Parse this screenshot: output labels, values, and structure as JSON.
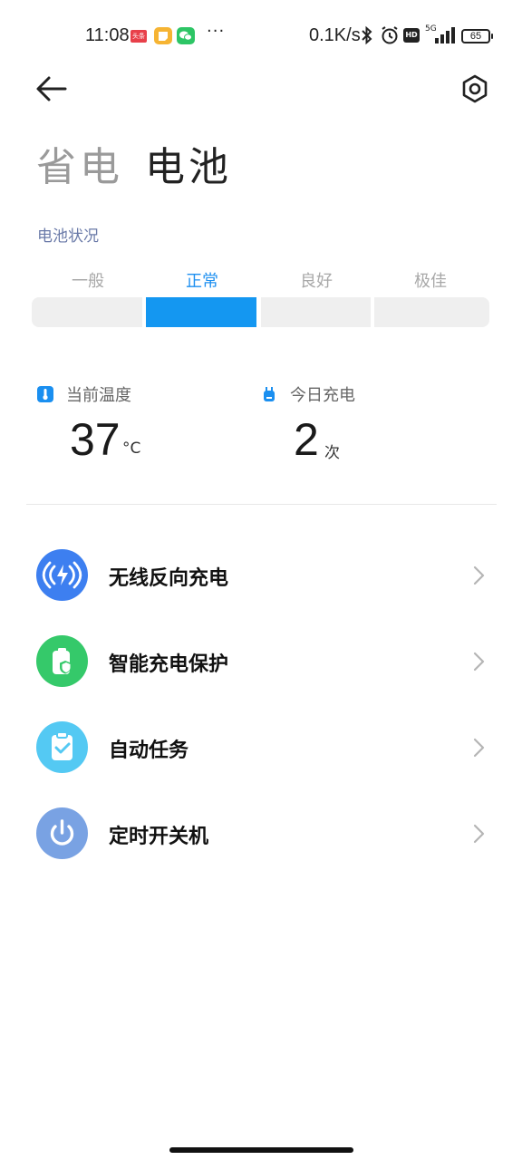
{
  "status_bar": {
    "time": "11:08",
    "toutiao_label": "头条",
    "more": "···",
    "network_speed": "0.1K/s",
    "signal_label": "5G",
    "hd_label": "HD",
    "battery_level": "65"
  },
  "header": {
    "tab_power_saving": "省电",
    "tab_battery": "电池"
  },
  "battery_condition": {
    "label": "电池状况",
    "levels": [
      "一般",
      "正常",
      "良好",
      "极佳"
    ],
    "active_index": 1,
    "active_color": "#1497f1"
  },
  "stats": {
    "temperature": {
      "label": "当前温度",
      "value": "37",
      "unit": "°C",
      "icon": "thermometer-icon"
    },
    "charges_today": {
      "label": "今日充电",
      "value": "2",
      "unit": "次",
      "icon": "plug-icon"
    }
  },
  "menu": [
    {
      "label": "无线反向充电",
      "icon": "wireless-charging-icon",
      "color": "#3d7ff0"
    },
    {
      "label": "智能充电保护",
      "icon": "battery-shield-icon",
      "color": "#35c96a"
    },
    {
      "label": "自动任务",
      "icon": "clipboard-check-icon",
      "color": "#54c9f3"
    },
    {
      "label": "定时开关机",
      "icon": "power-icon",
      "color": "#79a2e3"
    }
  ]
}
